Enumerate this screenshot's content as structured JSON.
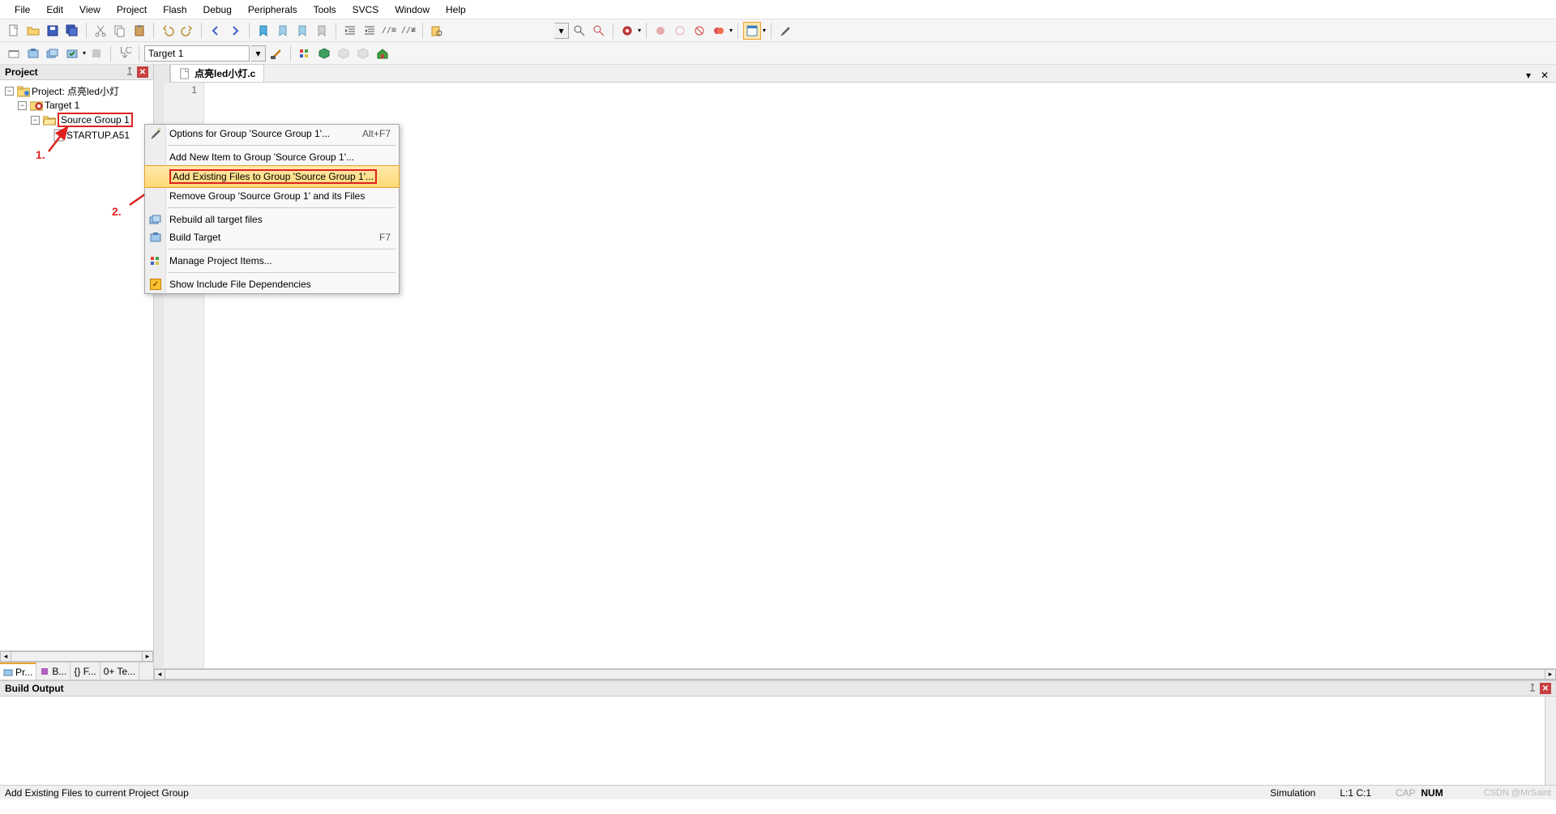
{
  "menubar": [
    "File",
    "Edit",
    "View",
    "Project",
    "Flash",
    "Debug",
    "Peripherals",
    "Tools",
    "SVCS",
    "Window",
    "Help"
  ],
  "toolbar2": {
    "target_value": "Target 1"
  },
  "project_panel": {
    "title": "Project",
    "root": "Project: 点亮led小灯",
    "target": "Target 1",
    "group": "Source Group 1",
    "file": "STARTUP.A51",
    "tabs": [
      "Pr...",
      "B...",
      "{} F...",
      "0+ Te..."
    ]
  },
  "editor": {
    "tab_name": "点亮led小灯.c",
    "line_no": "1"
  },
  "context_menu": {
    "options": {
      "label": "Options for Group 'Source Group 1'...",
      "shortcut": "Alt+F7"
    },
    "add_new": "Add New  Item to Group 'Source Group 1'...",
    "add_existing": "Add Existing Files to Group 'Source Group 1'...",
    "remove": "Remove Group 'Source Group 1' and its Files",
    "rebuild": "Rebuild all target files",
    "build": {
      "label": "Build Target",
      "shortcut": "F7"
    },
    "manage": "Manage Project Items...",
    "show_include": "Show Include File Dependencies"
  },
  "annotations": {
    "one": "1.",
    "two": "2."
  },
  "build_output": {
    "title": "Build Output"
  },
  "statusbar": {
    "hint": "Add Existing Files to current Project Group",
    "mode": "Simulation",
    "pos": "L:1 C:1",
    "caps": "CAP",
    "num": "NUM",
    "watermark": "CSDN @MrSaint"
  }
}
